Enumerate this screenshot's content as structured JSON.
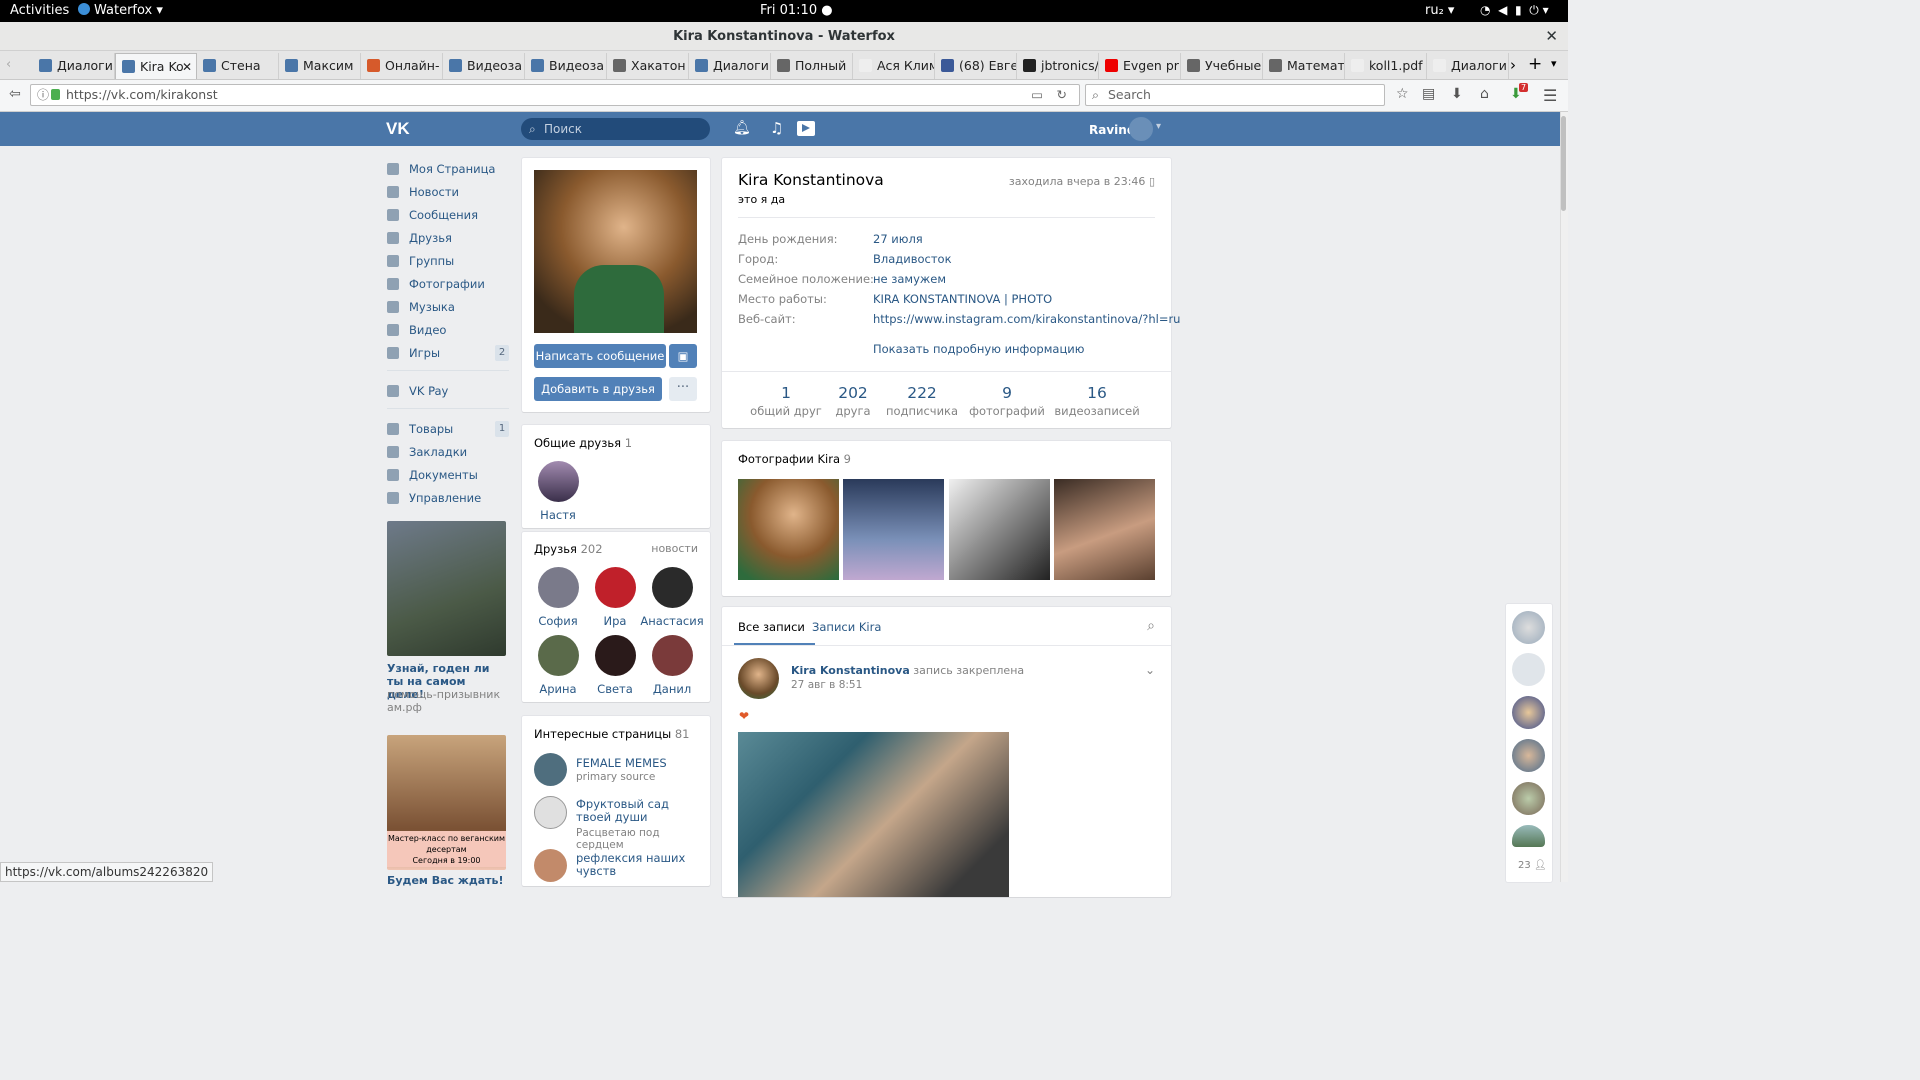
{
  "gnome": {
    "activities": "Activities",
    "app": "Waterfox",
    "clock": "Fri 01:10",
    "lang": "ru₂"
  },
  "window": {
    "title": "Kira Konstantinova - Waterfox"
  },
  "tabs": [
    {
      "label": "Диалоги"
    },
    {
      "label": "Kira Ko"
    },
    {
      "label": "Стена"
    },
    {
      "label": "Максим"
    },
    {
      "label": "Онлайн-"
    },
    {
      "label": "Видеоза"
    },
    {
      "label": "Видеоза"
    },
    {
      "label": "Хакатон"
    },
    {
      "label": "Диалоги"
    },
    {
      "label": "Полный"
    },
    {
      "label": "Ася Климан"
    },
    {
      "label": "(68) Евге"
    },
    {
      "label": "jbtronics/"
    },
    {
      "label": "Evgen pr"
    },
    {
      "label": "Учебные"
    },
    {
      "label": "Математ"
    },
    {
      "label": "koll1.pdf"
    },
    {
      "label": "Диалоги"
    }
  ],
  "nav": {
    "url": "https://vk.com/kirakonst",
    "search_placeholder": "Search",
    "downloads_badge": "7"
  },
  "vk": {
    "search_placeholder": "Поиск",
    "user_name": "Ravino",
    "menu": [
      {
        "label": "Моя Страница"
      },
      {
        "label": "Новости"
      },
      {
        "label": "Сообщения"
      },
      {
        "label": "Друзья"
      },
      {
        "label": "Группы"
      },
      {
        "label": "Фотографии"
      },
      {
        "label": "Музыка"
      },
      {
        "label": "Видео"
      },
      {
        "label": "Игры",
        "badge": "2"
      },
      {
        "label": "VK Pay"
      },
      {
        "label": "Товары",
        "badge": "1"
      },
      {
        "label": "Закладки"
      },
      {
        "label": "Документы"
      },
      {
        "label": "Управление"
      }
    ],
    "ads": [
      {
        "title": "Узнай, годен ли ты на самом деле!",
        "domain": "помощь-призывникам.рф"
      },
      {
        "image_text_1": "Мастер-класс по веганским десертам",
        "image_text_2": "Сегодня в 19:00",
        "title": "Будем Вас ждать!"
      }
    ],
    "profile": {
      "name": "Kira Konstantinova",
      "status": "это я да",
      "last_seen": "заходила вчера в 23:46",
      "rows": [
        {
          "label": "День рождения:",
          "value": "27 июля"
        },
        {
          "label": "Город:",
          "value": "Владивосток"
        },
        {
          "label": "Семейное положение:",
          "value": "не замужем"
        },
        {
          "label": "Место работы:",
          "value": "KIRA KONSTANTINOVA | PHOTO"
        },
        {
          "label": "Веб-сайт:",
          "value": "https://www.instagram.com/kirakonstantinova/?hl=ru"
        }
      ],
      "show_more": "Показать подробную информацию",
      "counters": [
        {
          "n": "1",
          "label": "общий друг"
        },
        {
          "n": "202",
          "label": "друга"
        },
        {
          "n": "222",
          "label": "подписчика"
        },
        {
          "n": "9",
          "label": "фотографий"
        },
        {
          "n": "16",
          "label": "видеозаписей"
        }
      ],
      "btn_message": "Написать сообщение",
      "btn_add": "Добавить в друзья",
      "btn_more": "···"
    },
    "common_friends": {
      "title": "Общие друзья",
      "count": "1",
      "items": [
        {
          "name": "Настя"
        }
      ]
    },
    "friends": {
      "title": "Друзья",
      "count": "202",
      "news": "новости",
      "items": [
        {
          "name": "София"
        },
        {
          "name": "Ира"
        },
        {
          "name": "Анастасия"
        },
        {
          "name": "Арина"
        },
        {
          "name": "Света"
        },
        {
          "name": "Данил"
        }
      ]
    },
    "interesting": {
      "title": "Интересные страницы",
      "count": "81",
      "items": [
        {
          "name": "FEMALE MEMES",
          "sub": "primary source"
        },
        {
          "name": "Фруктовый сад твоей души",
          "sub": "Расцветаю под сердцем"
        },
        {
          "name": "рефлексия наших чувств",
          "sub": ""
        }
      ]
    },
    "photos": {
      "title": "Фотографии Kira",
      "count": "9"
    },
    "wall": {
      "tab_all": "Все записи",
      "tab_own": "Записи Kira",
      "post_author": "Kira Konstantinova",
      "post_pinned": "запись закреплена",
      "post_date": "27 авг в 8:51"
    },
    "right_panel": {
      "count": "23"
    }
  },
  "statusbar": {
    "text": "https://vk.com/albums242263820"
  }
}
